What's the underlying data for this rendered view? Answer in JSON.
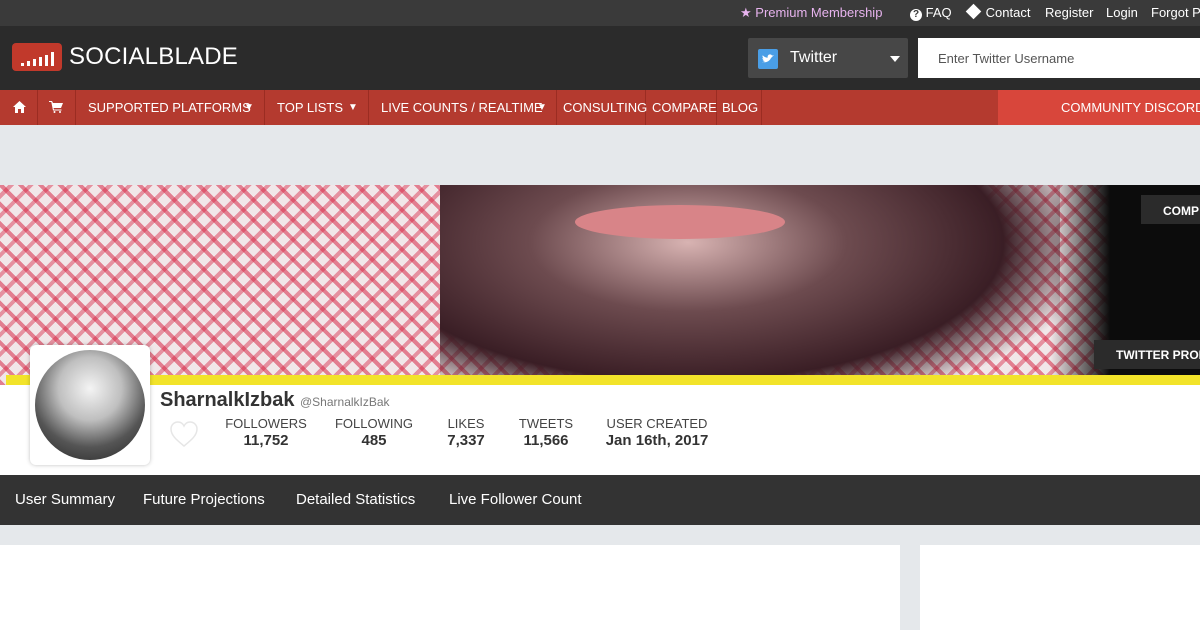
{
  "topbar": {
    "premium": "Premium Membership",
    "faq": "FAQ",
    "contact": "Contact",
    "register": "Register",
    "login": "Login",
    "forgot": "Forgot Pa"
  },
  "header": {
    "logo": "SOCIALBLADE",
    "platform": "Twitter",
    "search_placeholder": "Enter Twitter Username"
  },
  "nav": {
    "items": [
      "SUPPORTED PLATFORMS",
      "TOP LISTS",
      "LIVE COUNTS / REALTIME",
      "CONSULTING",
      "COMPARE",
      "BLOG"
    ],
    "discord": "COMMUNITY DISCORD"
  },
  "banner": {
    "compare_button": "COMP",
    "profile_button": "TWITTER PROF"
  },
  "profile": {
    "name": "SharnalkIzbak",
    "handle": "@SharnalkIzBak",
    "stats": [
      {
        "label": "FOLLOWERS",
        "value": "11,752"
      },
      {
        "label": "FOLLOWING",
        "value": "485"
      },
      {
        "label": "LIKES",
        "value": "7,337"
      },
      {
        "label": "TWEETS",
        "value": "11,566"
      },
      {
        "label": "USER CREATED",
        "value": "Jan 16th, 2017"
      }
    ]
  },
  "tabs": [
    "User Summary",
    "Future Projections",
    "Detailed Statistics",
    "Live Follower Count"
  ],
  "colors": {
    "nav_red": "#b43a2f",
    "discord_red": "#d8463b",
    "header_dark": "#2b2b2b",
    "premium_pink": "#e7b3ee",
    "twitter_blue": "#4a9ee6"
  }
}
